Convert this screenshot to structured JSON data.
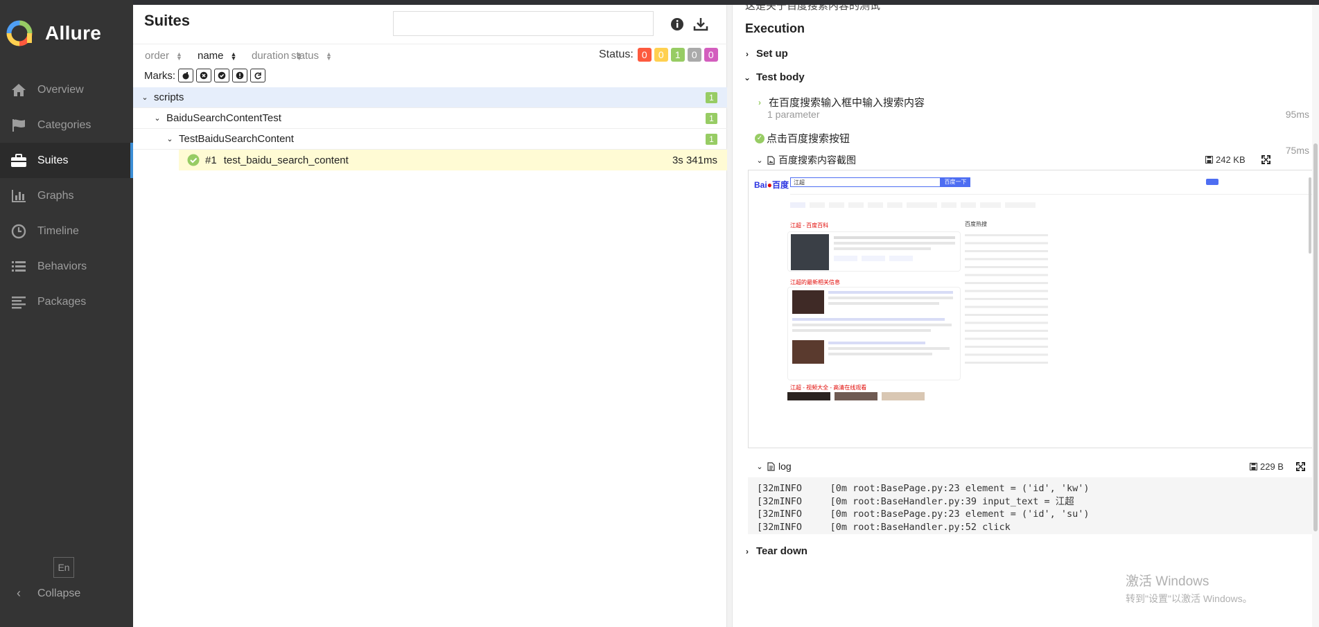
{
  "app": {
    "name": "Allure"
  },
  "sidebar": {
    "items": [
      {
        "label": "Overview",
        "icon": "home-icon"
      },
      {
        "label": "Categories",
        "icon": "flag-icon"
      },
      {
        "label": "Suites",
        "icon": "briefcase-icon"
      },
      {
        "label": "Graphs",
        "icon": "bar-chart-icon"
      },
      {
        "label": "Timeline",
        "icon": "clock-icon"
      },
      {
        "label": "Behaviors",
        "icon": "list-icon"
      },
      {
        "label": "Packages",
        "icon": "align-left-icon"
      }
    ],
    "active": "Suites",
    "lang": "En",
    "collapse": "Collapse"
  },
  "suites": {
    "title": "Suites",
    "search_value": "",
    "sort": {
      "order": "order",
      "name": "name",
      "duration": "duration",
      "status": "status"
    },
    "status_label": "Status:",
    "status_counts": [
      {
        "value": "0",
        "color": "#fd5a3e"
      },
      {
        "value": "0",
        "color": "#ffd050"
      },
      {
        "value": "1",
        "color": "#97cc64"
      },
      {
        "value": "0",
        "color": "#aaaaaa"
      },
      {
        "value": "0",
        "color": "#d35ebe"
      }
    ],
    "marks_label": "Marks:",
    "tree": {
      "root": {
        "name": "scripts",
        "count": "1"
      },
      "class": {
        "name": "BaiduSearchContentTest",
        "count": "1"
      },
      "suite": {
        "name": "TestBaiduSearchContent",
        "count": "1"
      },
      "test": {
        "index": "#1",
        "name": "test_baidu_search_content",
        "duration": "3s 341ms"
      }
    }
  },
  "execution": {
    "cut_text": "这是关于百度搜索内容的测试",
    "title": "Execution",
    "setup": "Set up",
    "test_body": "Test body",
    "step1": {
      "label": "在百度搜索输入框中输入搜索内容",
      "params": "1 parameter",
      "duration": "95ms"
    },
    "step2": {
      "label": "点击百度搜索按钮",
      "duration": "75ms"
    },
    "attachment": {
      "label": "百度搜索内容截图",
      "size": "242 KB"
    },
    "log": {
      "label": "log",
      "size": "229 B",
      "lines": [
        "[32mINFO     [0m root:BasePage.py:23 element = ('id', 'kw')",
        "[32mINFO     [0m root:BaseHandler.py:39 input_text = 江超",
        "[32mINFO     [0m root:BasePage.py:23 element = ('id', 'su')",
        "[32mINFO     [0m root:BaseHandler.py:52 click"
      ]
    },
    "teardown": "Tear down"
  },
  "screenshot": {
    "query": "江超",
    "search_button": "百度一下",
    "result1_title": "江超 - 百度百科",
    "result2_title": "江超的最新相关信息",
    "result3_title": "江超 - 视频大全 - 高清在线观看",
    "hot_title": "百度热搜"
  },
  "watermark": {
    "line1": "激活 Windows",
    "line2": "转到\"设置\"以激活 Windows。"
  }
}
